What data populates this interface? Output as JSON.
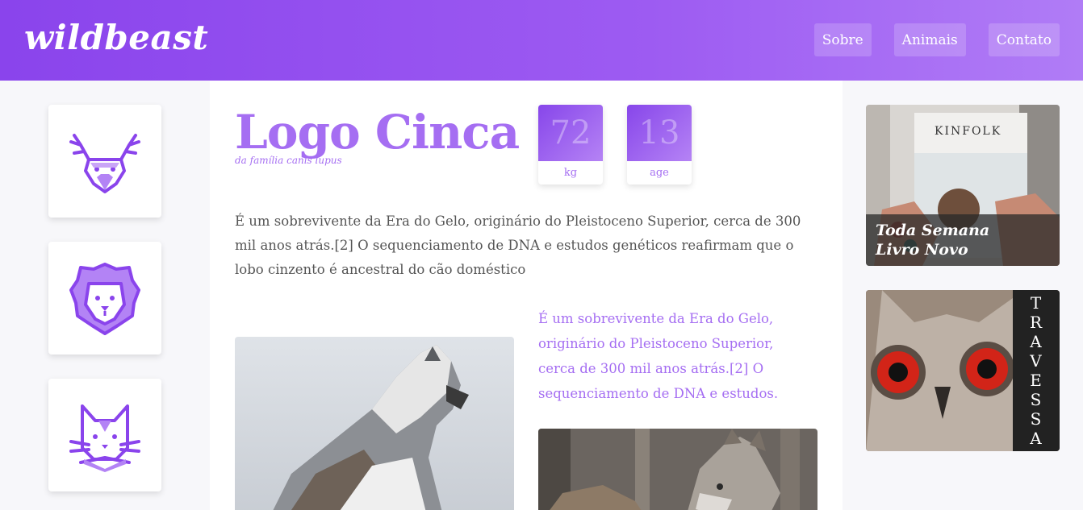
{
  "header": {
    "logo": "wildbeast",
    "nav": [
      {
        "label": "Sobre"
      },
      {
        "label": "Animais"
      },
      {
        "label": "Contato"
      }
    ]
  },
  "sidebar": {
    "icons": [
      "deer-icon",
      "lion-icon",
      "cat-icon"
    ]
  },
  "main": {
    "title": "Logo Cinca",
    "subtitle": "da família canis lupus",
    "stats": [
      {
        "value": "72",
        "unit": "kg"
      },
      {
        "value": "13",
        "unit": "age"
      }
    ],
    "paragraph": "É um sobrevivente da Era do Gelo, originário do Pleistoceno Superior, cerca de 300 mil anos atrás.[2] O sequenciamento de DNA e estudos genéticos reafirmam que o lobo cinzento é ancestral do cão doméstico",
    "highlight": "É um sobrevivente da Era do Gelo, originário do Pleistoceno Superior, cerca de 300 mil anos atrás.[2] O sequenciamento de DNA e estudos."
  },
  "ads": {
    "first": {
      "line1": "Toda Semana",
      "line2": "Livro Novo",
      "book": "KINFOLK"
    },
    "second": {
      "letters": [
        "T",
        "R",
        "A",
        "V",
        "E",
        "S",
        "S",
        "A"
      ]
    }
  },
  "colors": {
    "accent": "#a56ef2",
    "header_start": "#8a44ec",
    "header_end": "#b07cf6"
  }
}
